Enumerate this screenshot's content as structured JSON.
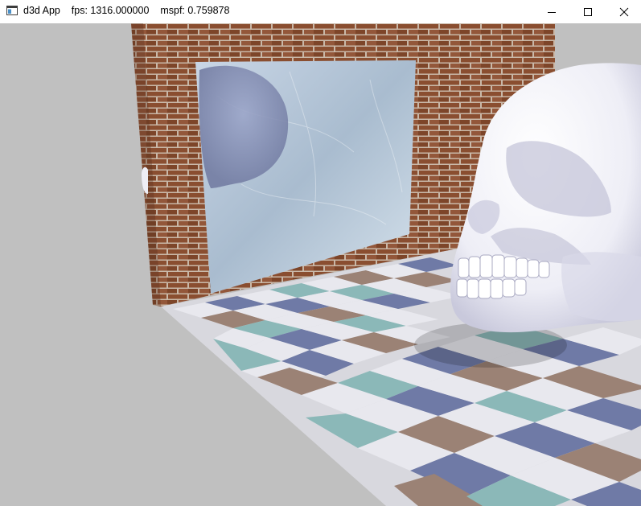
{
  "window": {
    "title": "d3d App",
    "fps_label": "fps: 1316.000000",
    "mspf_label": "mspf: 0.759878",
    "buttons": {
      "minimize_icon": "minimize-icon",
      "maximize_icon": "maximize-icon",
      "close_icon": "close-icon"
    }
  },
  "scene": {
    "background_color": "#c0c0c0",
    "brick_color": "#8a4e30",
    "mortar_color": "#c9b8a8",
    "mirror_color": "#b9c8d8",
    "skull_color": "#f4f4fa",
    "tile_colors": [
      "#e8e8ee",
      "#6f7aa6",
      "#8bb8b8",
      "#9b8275"
    ]
  }
}
